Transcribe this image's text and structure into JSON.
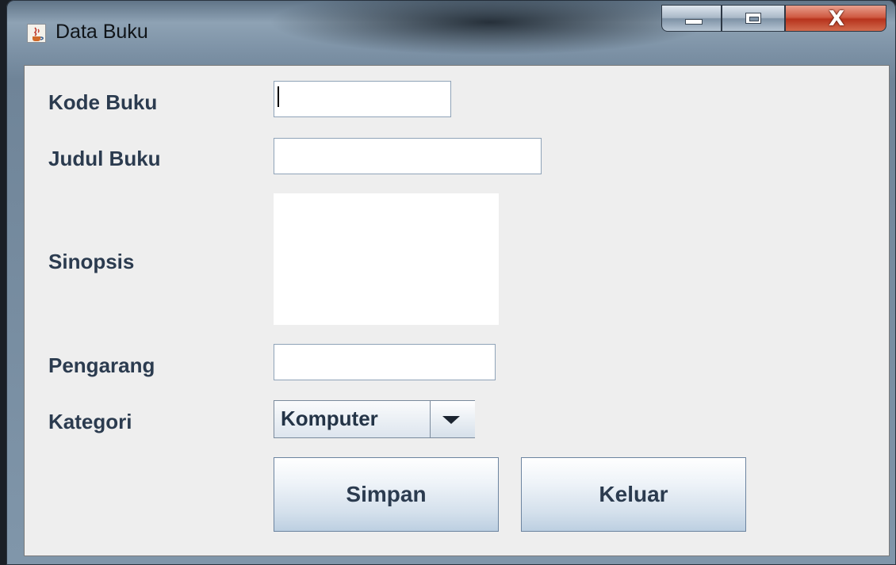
{
  "window": {
    "title": "Data Buku",
    "close_symbol": "X"
  },
  "form": {
    "fields": {
      "kode_buku": {
        "label": "Kode Buku",
        "value": ""
      },
      "judul_buku": {
        "label": "Judul Buku",
        "value": ""
      },
      "sinopsis": {
        "label": "Sinopsis",
        "value": ""
      },
      "pengarang": {
        "label": "Pengarang",
        "value": ""
      },
      "kategori": {
        "label": "Kategori",
        "selected": "Komputer"
      }
    },
    "buttons": {
      "simpan": "Simpan",
      "keluar": "Keluar"
    }
  },
  "icons": {
    "app": "java-coffee-icon",
    "minimize": "minimize-icon",
    "maximize": "maximize-icon",
    "close": "close-icon",
    "dropdown": "chevron-down-icon"
  },
  "colors": {
    "label_text": "#2b3b4f",
    "panel_bg": "#eeeeee",
    "close_button": "#c4442b"
  }
}
